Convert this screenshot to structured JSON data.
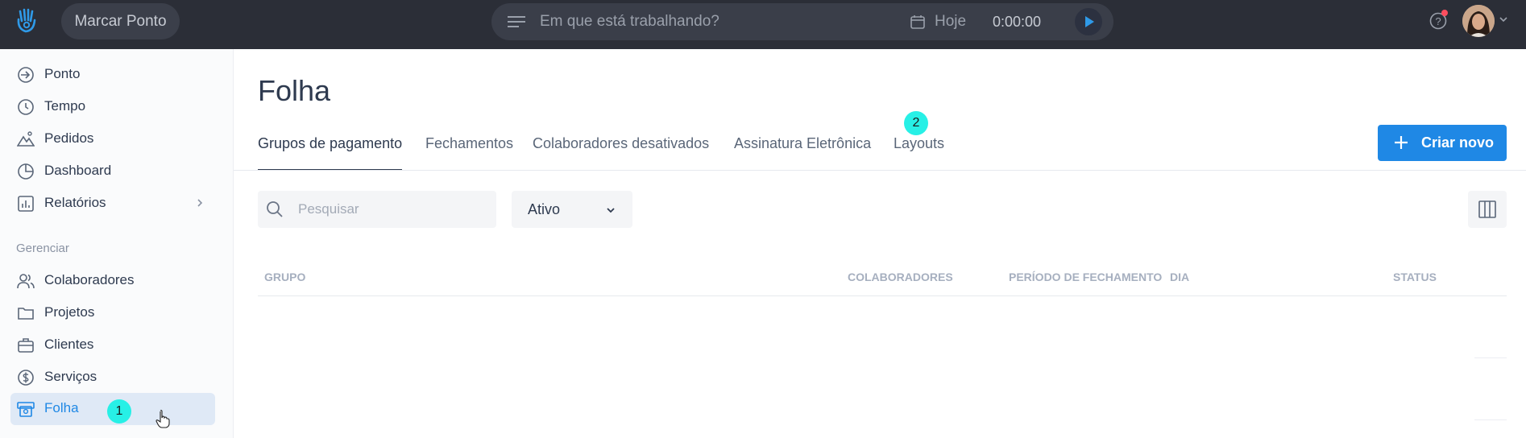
{
  "topbar": {
    "marcar_ponto": "Marcar Ponto",
    "task_placeholder": "Em que está trabalhando?",
    "date_label": "Hoje",
    "timer": "0:00:00",
    "notification_color": "#ff4d5e"
  },
  "sidebar": {
    "items": [
      {
        "label": "Ponto",
        "icon": "sign-in-icon"
      },
      {
        "label": "Tempo",
        "icon": "clock-icon"
      },
      {
        "label": "Pedidos",
        "icon": "mountain-icon"
      },
      {
        "label": "Dashboard",
        "icon": "pie-chart-icon"
      },
      {
        "label": "Relatórios",
        "icon": "bar-chart-icon"
      }
    ],
    "section_label": "Gerenciar",
    "manage_items": [
      {
        "label": "Colaboradores",
        "icon": "users-icon"
      },
      {
        "label": "Projetos",
        "icon": "folder-icon"
      },
      {
        "label": "Clientes",
        "icon": "briefcase-icon"
      },
      {
        "label": "Serviços",
        "icon": "dollar-circle-icon"
      },
      {
        "label": "Folha",
        "icon": "payroll-icon",
        "active": true
      }
    ]
  },
  "badges": {
    "first": "1",
    "second": "2"
  },
  "main": {
    "title": "Folha",
    "tabs": [
      {
        "label": "Grupos de pagamento",
        "active": true
      },
      {
        "label": "Fechamentos"
      },
      {
        "label": "Colaboradores desativados"
      },
      {
        "label": "Assinatura Eletrônica"
      },
      {
        "label": "Layouts"
      }
    ],
    "create_button": "Criar novo",
    "search_placeholder": "Pesquisar",
    "status_filter": "Ativo",
    "table_headers": {
      "grupo": "GRUPO",
      "colaboradores": "COLABORADORES",
      "periodo": "PERÍODO DE FECHAMENTO",
      "dia": "DIA",
      "status": "STATUS"
    }
  },
  "colors": {
    "accent": "#1f88e5",
    "topbar": "#2b2e37",
    "badge": "#27f0e6"
  }
}
